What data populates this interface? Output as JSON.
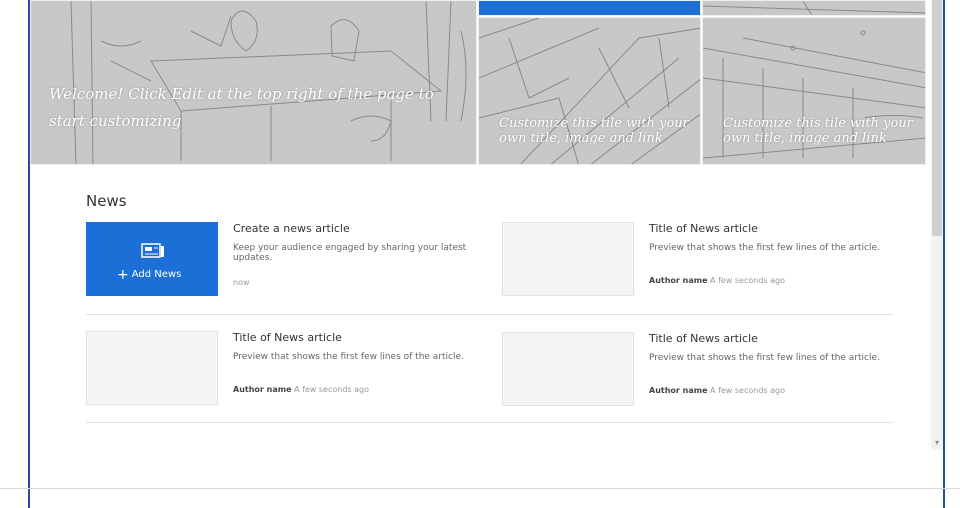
{
  "hero": {
    "main_tile_text": "Welcome! Click Edit at the top right of the page to start customizing",
    "tile_a_text": "Customize this tile with your own title, image and link",
    "tile_b_text": "Customize this tile with your own title, image and link"
  },
  "news": {
    "title": "News",
    "create": {
      "button_label": "Add News",
      "title": "Create a news article",
      "description": "Keep your audience engaged by sharing your latest updates.",
      "time": "now"
    },
    "articles": [
      {
        "title": "Title of News article",
        "preview": "Preview that shows the first few lines of the article.",
        "author": "Author name",
        "time": "A few seconds ago"
      },
      {
        "title": "Title of News article",
        "preview": "Preview that shows the first few lines of the article.",
        "author": "Author name",
        "time": "A few seconds ago"
      },
      {
        "title": "Title of News article",
        "preview": "Preview that shows the first few lines of the article.",
        "author": "Author name",
        "time": "A few seconds ago"
      }
    ]
  },
  "colors": {
    "accent": "#1b6fd6",
    "frame": "#2c4a9a",
    "tile_gray": "#c8c8c8"
  },
  "icons": {
    "scroll_down": "▾",
    "add": "+"
  }
}
